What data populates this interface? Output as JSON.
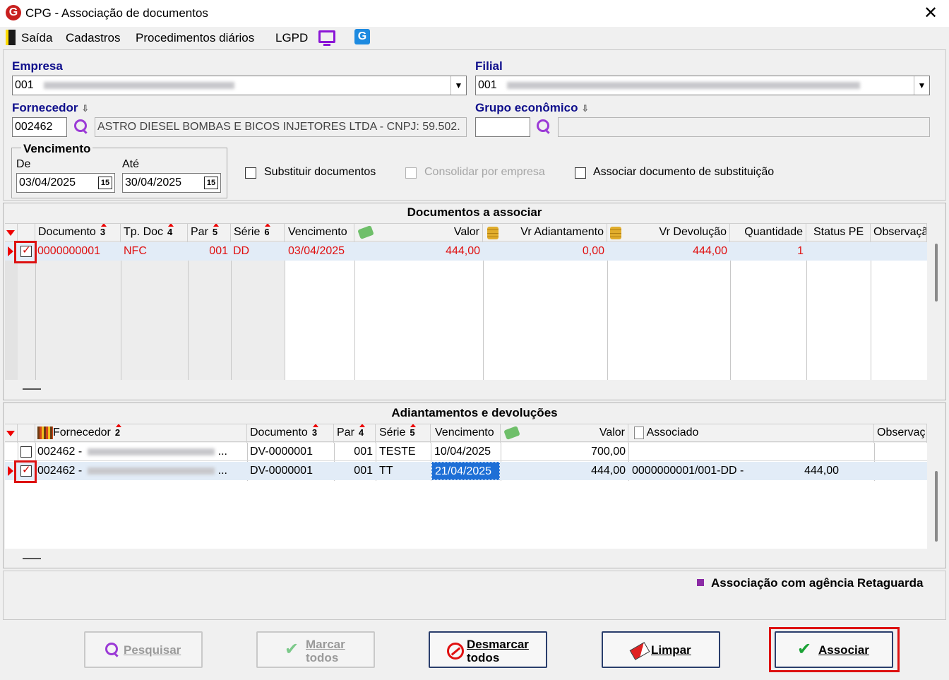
{
  "window": {
    "title": "CPG - Associação de documentos",
    "close": "✕"
  },
  "menu": [
    "Saída",
    "Cadastros",
    "Procedimentos diários",
    "LGPD"
  ],
  "filters": {
    "empresa_label": "Empresa",
    "empresa_code": "001",
    "filial_label": "Filial",
    "filial_code": "001",
    "fornecedor_label": "Fornecedor",
    "fornecedor_code": "002462",
    "fornecedor_name": "ASTRO DIESEL BOMBAS E BICOS INJETORES LTDA - CNPJ: 59.502.",
    "grupo_label": "Grupo econômico",
    "grupo_code": "",
    "grupo_name": "",
    "vencimento_label": "Vencimento",
    "de_label": "De",
    "de_value": "03/04/2025",
    "ate_label": "Até",
    "ate_value": "30/04/2025",
    "calendar_glyph": "15",
    "substituir_label": "Substituir documentos",
    "consolidar_label": "Consolidar por empresa",
    "associar_sub_label": "Associar documento de substituição"
  },
  "docs_grid": {
    "title": "Documentos a associar",
    "columns": [
      {
        "label": "Documento",
        "ord": "3"
      },
      {
        "label": "Tp. Doc",
        "ord": "4"
      },
      {
        "label": "Par",
        "ord": "5"
      },
      {
        "label": "Série",
        "ord": "6"
      },
      {
        "label": "Vencimento",
        "ord": ""
      },
      {
        "label": "Valor",
        "ord": ""
      },
      {
        "label": "Vr Adiantamento",
        "ord": ""
      },
      {
        "label": "Vr Devolução",
        "ord": ""
      },
      {
        "label": "Quantidade",
        "ord": ""
      },
      {
        "label": "Status PE",
        "ord": ""
      },
      {
        "label": "Observaçã",
        "ord": ""
      }
    ],
    "rows": [
      {
        "checked": true,
        "documento": "0000000001",
        "tpdoc": "NFC",
        "par": "001",
        "serie": "DD",
        "vencimento": "03/04/2025",
        "valor": "444,00",
        "vr_adiant": "0,00",
        "vr_devol": "444,00",
        "quantidade": "1",
        "status": "",
        "obs": ""
      }
    ]
  },
  "adiant_grid": {
    "title": "Adiantamentos e devoluções",
    "columns": [
      {
        "label": "Fornecedor",
        "ord": "2"
      },
      {
        "label": "Documento",
        "ord": "3"
      },
      {
        "label": "Par",
        "ord": "4"
      },
      {
        "label": "Série",
        "ord": "5"
      },
      {
        "label": "Vencimento",
        "ord": ""
      },
      {
        "label": "Valor",
        "ord": ""
      },
      {
        "label": "Associado",
        "ord": ""
      },
      {
        "label": "Observaç",
        "ord": ""
      }
    ],
    "rows": [
      {
        "checked": false,
        "fornecedor": "002462 -",
        "ellipsis": "...",
        "documento": "DV-0000001",
        "par": "001",
        "serie": "TESTE",
        "vencimento": "10/04/2025",
        "valor": "700,00",
        "associado": "",
        "assoc_valor": ""
      },
      {
        "checked": true,
        "fornecedor": "002462 -",
        "ellipsis": "...",
        "documento": "DV-0000001",
        "par": "001",
        "serie": "TT",
        "vencimento": "21/04/2025",
        "valor": "444,00",
        "associado": "0000000001/001-DD   -",
        "assoc_valor": "444,00"
      }
    ]
  },
  "legend": {
    "text": "Associação com agência Retaguarda",
    "color": "#8b2ba5"
  },
  "buttons": {
    "pesquisar": "Pesquisar",
    "marcar_1": "Marcar",
    "marcar_2": "todos",
    "desmarcar_1": "Desmarcar",
    "desmarcar_2": "todos",
    "limpar": "Limpar",
    "associar": "Associar"
  },
  "colors": {
    "label_blue": "#0f0f8c",
    "row_red": "#e01010",
    "selected_cell": "#1e6fd6",
    "highlight_box": "#d11111"
  }
}
